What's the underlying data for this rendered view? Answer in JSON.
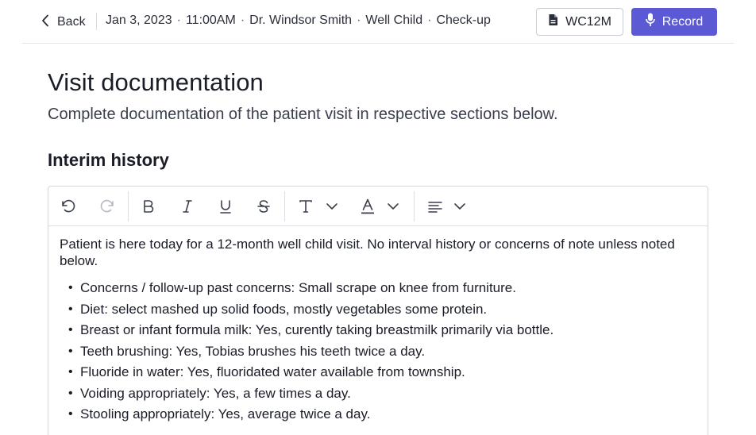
{
  "nav": {
    "back_label": "Back",
    "breadcrumbs": [
      "Jan 3, 2023",
      "11:00AM",
      "Dr. Windsor Smith",
      "Well Child",
      "Check-up"
    ],
    "separator": "·"
  },
  "actions": {
    "code_label": "WC12M",
    "record_label": "Record",
    "record_color": "#5b59d4"
  },
  "page": {
    "title": "Visit documentation",
    "subtitle": "Complete documentation of the patient visit in respective sections below.",
    "section_title": "Interim history"
  },
  "toolbar": {
    "icons": [
      "undo-icon",
      "redo-icon",
      "bold-icon",
      "italic-icon",
      "underline-icon",
      "strikethrough-icon",
      "font-size-icon",
      "text-color-icon",
      "align-icon"
    ]
  },
  "editor": {
    "intro": "Patient is here today for a 12-month well child visit. No interval history or concerns of note unless noted below.",
    "items": [
      "Concerns / follow-up past concerns: Small scrape on knee from furniture.",
      "Diet: select mashed up solid foods, mostly vegetables some protein.",
      "Breast or infant formula milk: Yes, curently taking breastmilk primarily via bottle.",
      "Teeth brushing: Yes, Tobias brushes his teeth twice a day.",
      "Fluoride in water: Yes, fluoridated water available from township.",
      "Voiding appropriately: Yes, a few times a day.",
      "Stooling appropriately: Yes, average twice a day."
    ]
  }
}
